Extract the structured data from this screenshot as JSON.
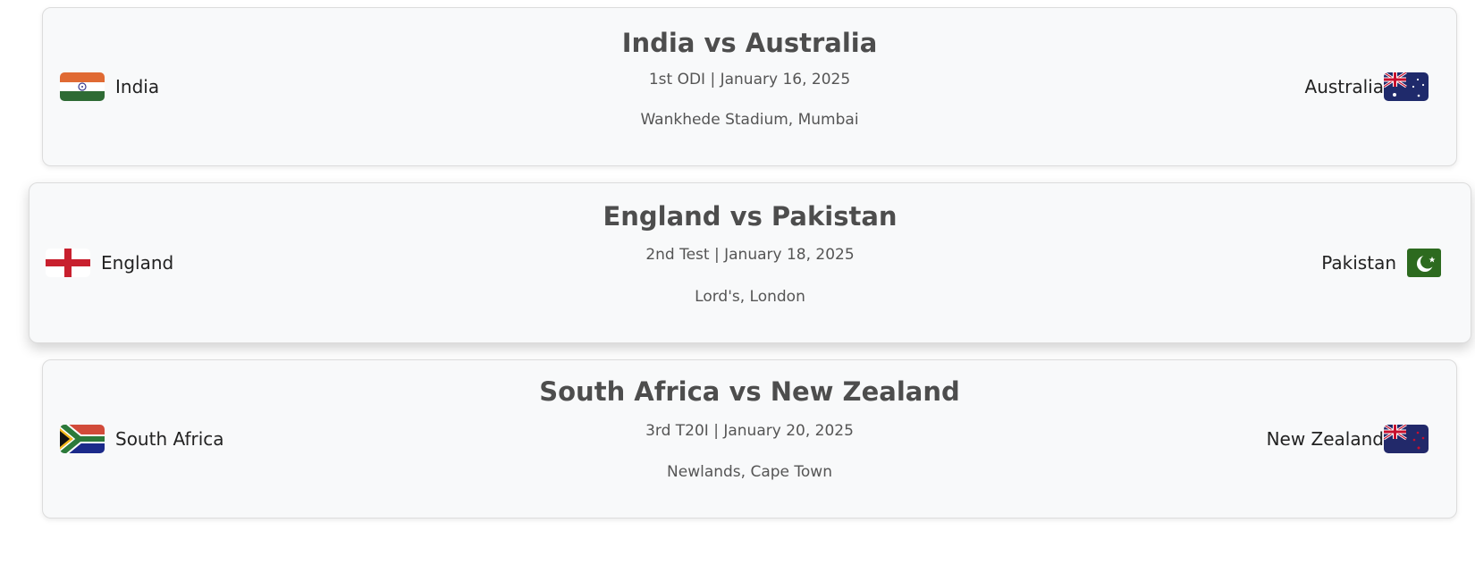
{
  "matches": [
    {
      "title": "India vs Australia",
      "info": "1st ODI | January 16, 2025",
      "venue": "Wankhede Stadium, Mumbai",
      "team1": {
        "name": "India",
        "flag": "india-flag-icon"
      },
      "team2": {
        "name": "Australia",
        "flag": "australia-flag-icon"
      }
    },
    {
      "title": "England vs Pakistan",
      "info": "2nd Test | January 18, 2025",
      "venue": "Lord's, London",
      "team1": {
        "name": "England",
        "flag": "england-flag-icon"
      },
      "team2": {
        "name": "Pakistan",
        "flag": "pakistan-flag-icon"
      }
    },
    {
      "title": "South Africa vs New Zealand",
      "info": "3rd T20I | January 20, 2025",
      "venue": "Newlands, Cape Town",
      "team1": {
        "name": "South Africa",
        "flag": "south-africa-flag-icon"
      },
      "team2": {
        "name": "New Zealand",
        "flag": "new-zealand-flag-icon"
      }
    }
  ],
  "colors": {
    "card_bg": "#f8f9fa",
    "title_text": "#4d4d4d",
    "meta_text": "#555555"
  }
}
